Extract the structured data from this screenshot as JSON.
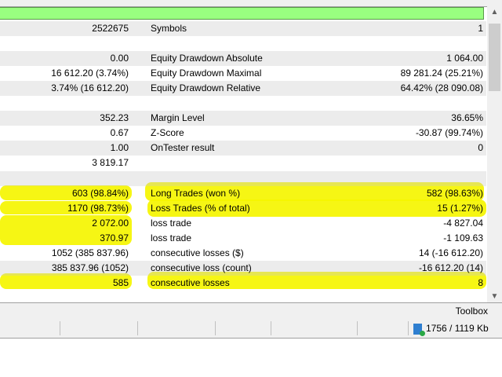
{
  "rows": [
    {
      "v1": "2522675",
      "label": "Symbols",
      "v2": "1"
    },
    {
      "v1": "",
      "label": "",
      "v2": ""
    },
    {
      "v1": "0.00",
      "label": "Equity Drawdown Absolute",
      "v2": "1 064.00"
    },
    {
      "v1": "16 612.20 (3.74%)",
      "label": "Equity Drawdown Maximal",
      "v2": "89 281.24 (25.21%)"
    },
    {
      "v1": "3.74% (16 612.20)",
      "label": "Equity Drawdown Relative",
      "v2": "64.42% (28 090.08)"
    },
    {
      "v1": "",
      "label": "",
      "v2": ""
    },
    {
      "v1": "352.23",
      "label": "Margin Level",
      "v2": "36.65%"
    },
    {
      "v1": "0.67",
      "label": "Z-Score",
      "v2": "-30.87 (99.74%)"
    },
    {
      "v1": "1.00",
      "label": "OnTester result",
      "v2": "0"
    },
    {
      "v1": "3 819.17",
      "label": "",
      "v2": ""
    },
    {
      "v1": "",
      "label": "",
      "v2": ""
    },
    {
      "v1": "603 (98.84%)",
      "label": "Long Trades (won %)",
      "v2": "582 (98.63%)"
    },
    {
      "v1": "1170 (98.73%)",
      "label": "Loss Trades (% of total)",
      "v2": "15 (1.27%)"
    },
    {
      "v1": "2 072.00",
      "label": "loss trade",
      "v2": "-4 827.04"
    },
    {
      "v1": "370.97",
      "label": "loss trade",
      "v2": "-1 109.63"
    },
    {
      "v1": "1052 (385 837.96)",
      "label": "consecutive losses ($)",
      "v2": "14 (-16 612.20)"
    },
    {
      "v1": "385 837.96 (1052)",
      "label": "consecutive loss (count)",
      "v2": "-16 612.20 (14)"
    },
    {
      "v1": "585",
      "label": "consecutive losses",
      "v2": "8"
    }
  ],
  "toolbox": {
    "label": "Toolbox"
  },
  "status": {
    "memory": "1756 / 1119 Kb"
  },
  "colors": {
    "progress": "#99ff80",
    "highlight": "#f5f500"
  }
}
